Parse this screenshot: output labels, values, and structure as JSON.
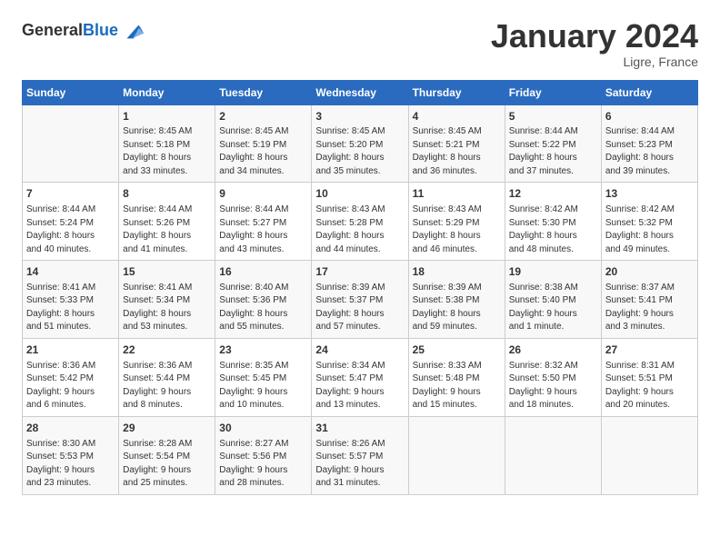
{
  "header": {
    "logo_general": "General",
    "logo_blue": "Blue",
    "main_title": "January 2024",
    "subtitle": "Ligre, France"
  },
  "days_of_week": [
    "Sunday",
    "Monday",
    "Tuesday",
    "Wednesday",
    "Thursday",
    "Friday",
    "Saturday"
  ],
  "weeks": [
    [
      {
        "day": "",
        "info": ""
      },
      {
        "day": "1",
        "info": "Sunrise: 8:45 AM\nSunset: 5:18 PM\nDaylight: 8 hours\nand 33 minutes."
      },
      {
        "day": "2",
        "info": "Sunrise: 8:45 AM\nSunset: 5:19 PM\nDaylight: 8 hours\nand 34 minutes."
      },
      {
        "day": "3",
        "info": "Sunrise: 8:45 AM\nSunset: 5:20 PM\nDaylight: 8 hours\nand 35 minutes."
      },
      {
        "day": "4",
        "info": "Sunrise: 8:45 AM\nSunset: 5:21 PM\nDaylight: 8 hours\nand 36 minutes."
      },
      {
        "day": "5",
        "info": "Sunrise: 8:44 AM\nSunset: 5:22 PM\nDaylight: 8 hours\nand 37 minutes."
      },
      {
        "day": "6",
        "info": "Sunrise: 8:44 AM\nSunset: 5:23 PM\nDaylight: 8 hours\nand 39 minutes."
      }
    ],
    [
      {
        "day": "7",
        "info": "Sunrise: 8:44 AM\nSunset: 5:24 PM\nDaylight: 8 hours\nand 40 minutes."
      },
      {
        "day": "8",
        "info": "Sunrise: 8:44 AM\nSunset: 5:26 PM\nDaylight: 8 hours\nand 41 minutes."
      },
      {
        "day": "9",
        "info": "Sunrise: 8:44 AM\nSunset: 5:27 PM\nDaylight: 8 hours\nand 43 minutes."
      },
      {
        "day": "10",
        "info": "Sunrise: 8:43 AM\nSunset: 5:28 PM\nDaylight: 8 hours\nand 44 minutes."
      },
      {
        "day": "11",
        "info": "Sunrise: 8:43 AM\nSunset: 5:29 PM\nDaylight: 8 hours\nand 46 minutes."
      },
      {
        "day": "12",
        "info": "Sunrise: 8:42 AM\nSunset: 5:30 PM\nDaylight: 8 hours\nand 48 minutes."
      },
      {
        "day": "13",
        "info": "Sunrise: 8:42 AM\nSunset: 5:32 PM\nDaylight: 8 hours\nand 49 minutes."
      }
    ],
    [
      {
        "day": "14",
        "info": "Sunrise: 8:41 AM\nSunset: 5:33 PM\nDaylight: 8 hours\nand 51 minutes."
      },
      {
        "day": "15",
        "info": "Sunrise: 8:41 AM\nSunset: 5:34 PM\nDaylight: 8 hours\nand 53 minutes."
      },
      {
        "day": "16",
        "info": "Sunrise: 8:40 AM\nSunset: 5:36 PM\nDaylight: 8 hours\nand 55 minutes."
      },
      {
        "day": "17",
        "info": "Sunrise: 8:39 AM\nSunset: 5:37 PM\nDaylight: 8 hours\nand 57 minutes."
      },
      {
        "day": "18",
        "info": "Sunrise: 8:39 AM\nSunset: 5:38 PM\nDaylight: 8 hours\nand 59 minutes."
      },
      {
        "day": "19",
        "info": "Sunrise: 8:38 AM\nSunset: 5:40 PM\nDaylight: 9 hours\nand 1 minute."
      },
      {
        "day": "20",
        "info": "Sunrise: 8:37 AM\nSunset: 5:41 PM\nDaylight: 9 hours\nand 3 minutes."
      }
    ],
    [
      {
        "day": "21",
        "info": "Sunrise: 8:36 AM\nSunset: 5:42 PM\nDaylight: 9 hours\nand 6 minutes."
      },
      {
        "day": "22",
        "info": "Sunrise: 8:36 AM\nSunset: 5:44 PM\nDaylight: 9 hours\nand 8 minutes."
      },
      {
        "day": "23",
        "info": "Sunrise: 8:35 AM\nSunset: 5:45 PM\nDaylight: 9 hours\nand 10 minutes."
      },
      {
        "day": "24",
        "info": "Sunrise: 8:34 AM\nSunset: 5:47 PM\nDaylight: 9 hours\nand 13 minutes."
      },
      {
        "day": "25",
        "info": "Sunrise: 8:33 AM\nSunset: 5:48 PM\nDaylight: 9 hours\nand 15 minutes."
      },
      {
        "day": "26",
        "info": "Sunrise: 8:32 AM\nSunset: 5:50 PM\nDaylight: 9 hours\nand 18 minutes."
      },
      {
        "day": "27",
        "info": "Sunrise: 8:31 AM\nSunset: 5:51 PM\nDaylight: 9 hours\nand 20 minutes."
      }
    ],
    [
      {
        "day": "28",
        "info": "Sunrise: 8:30 AM\nSunset: 5:53 PM\nDaylight: 9 hours\nand 23 minutes."
      },
      {
        "day": "29",
        "info": "Sunrise: 8:28 AM\nSunset: 5:54 PM\nDaylight: 9 hours\nand 25 minutes."
      },
      {
        "day": "30",
        "info": "Sunrise: 8:27 AM\nSunset: 5:56 PM\nDaylight: 9 hours\nand 28 minutes."
      },
      {
        "day": "31",
        "info": "Sunrise: 8:26 AM\nSunset: 5:57 PM\nDaylight: 9 hours\nand 31 minutes."
      },
      {
        "day": "",
        "info": ""
      },
      {
        "day": "",
        "info": ""
      },
      {
        "day": "",
        "info": ""
      }
    ]
  ]
}
